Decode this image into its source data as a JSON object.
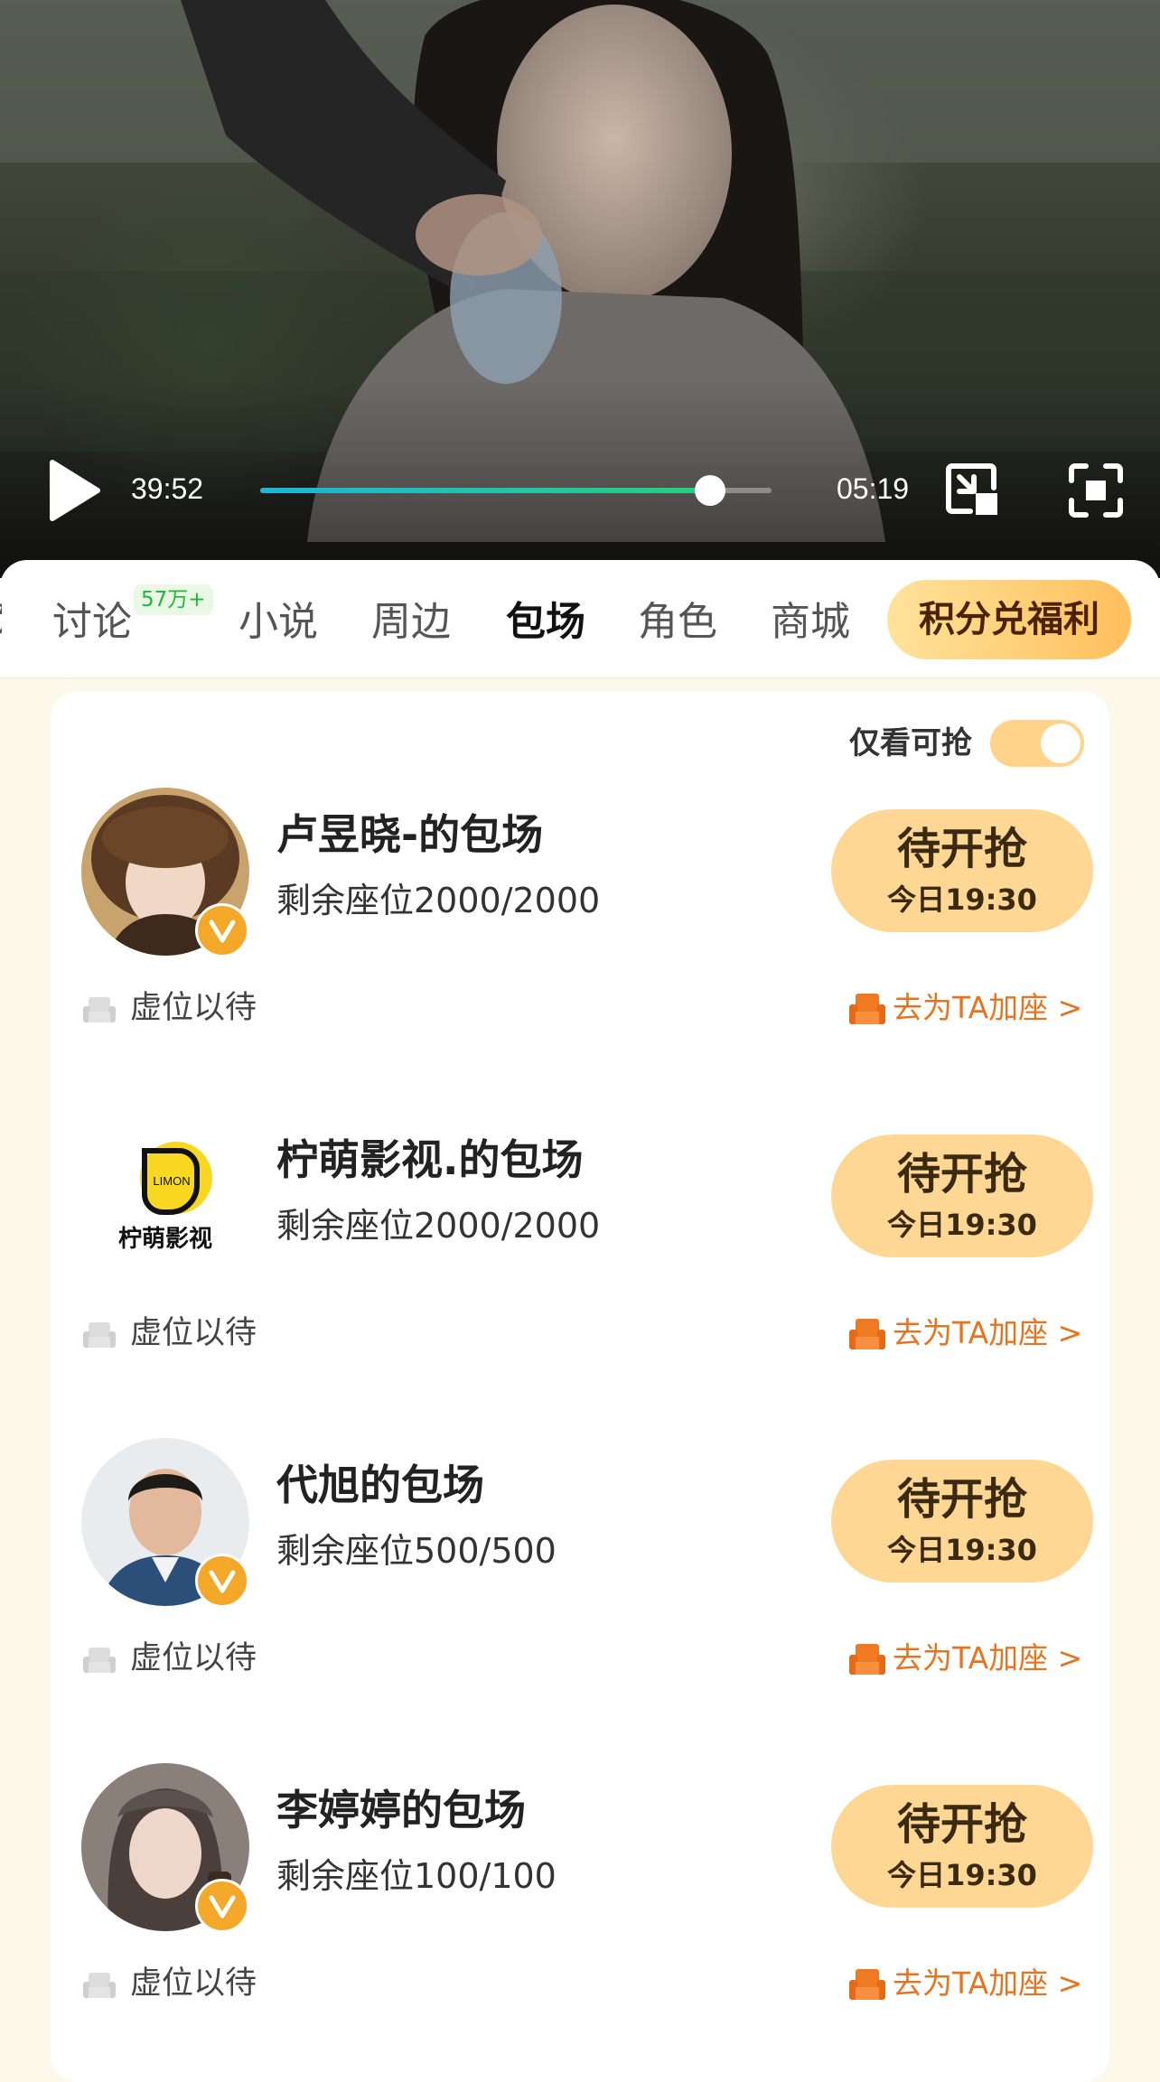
{
  "player": {
    "current_time": "39:52",
    "remaining_time": "05:19",
    "progress": 0.88
  },
  "tabs": {
    "partial_label": "页",
    "items": [
      {
        "label": "讨论",
        "active": false
      },
      {
        "label": "小说",
        "active": false
      },
      {
        "label": "周边",
        "active": false
      },
      {
        "label": "包场",
        "active": true
      },
      {
        "label": "角色",
        "active": false
      },
      {
        "label": "商城",
        "active": false
      }
    ],
    "discussion_badge": "57万+",
    "points_button": "积分兑福利"
  },
  "filter": {
    "label": "仅看可抢",
    "enabled": true
  },
  "cards": [
    {
      "title": "卢昱晓-的包场",
      "seats": "剩余座位2000/2000",
      "button": "待开抢",
      "time": "今日19:30",
      "wait": "虚位以待",
      "action": "去为TA加座 >",
      "verified": true
    },
    {
      "title": "柠萌影视.的包场",
      "seats": "剩余座位2000/2000",
      "button": "待开抢",
      "time": "今日19:30",
      "wait": "虚位以待",
      "action": "去为TA加座 >",
      "verified": false
    },
    {
      "title": "代旭的包场",
      "seats": "剩余座位500/500",
      "button": "待开抢",
      "time": "今日19:30",
      "wait": "虚位以待",
      "action": "去为TA加座 >",
      "verified": true
    },
    {
      "title": "李婷婷的包场",
      "seats": "剩余座位100/100",
      "button": "待开抢",
      "time": "今日19:30",
      "wait": "虚位以待",
      "action": "去为TA加座 >",
      "verified": true
    }
  ],
  "logo": {
    "badge_text": "LIMON",
    "name_text": "柠萌影视"
  },
  "colors": {
    "accent_orange": "#e8731f",
    "button_bg": "#ffd795",
    "progress_start": "#1fb3d9",
    "progress_end": "#26d07c",
    "page_bg": "#fdf9ea"
  }
}
